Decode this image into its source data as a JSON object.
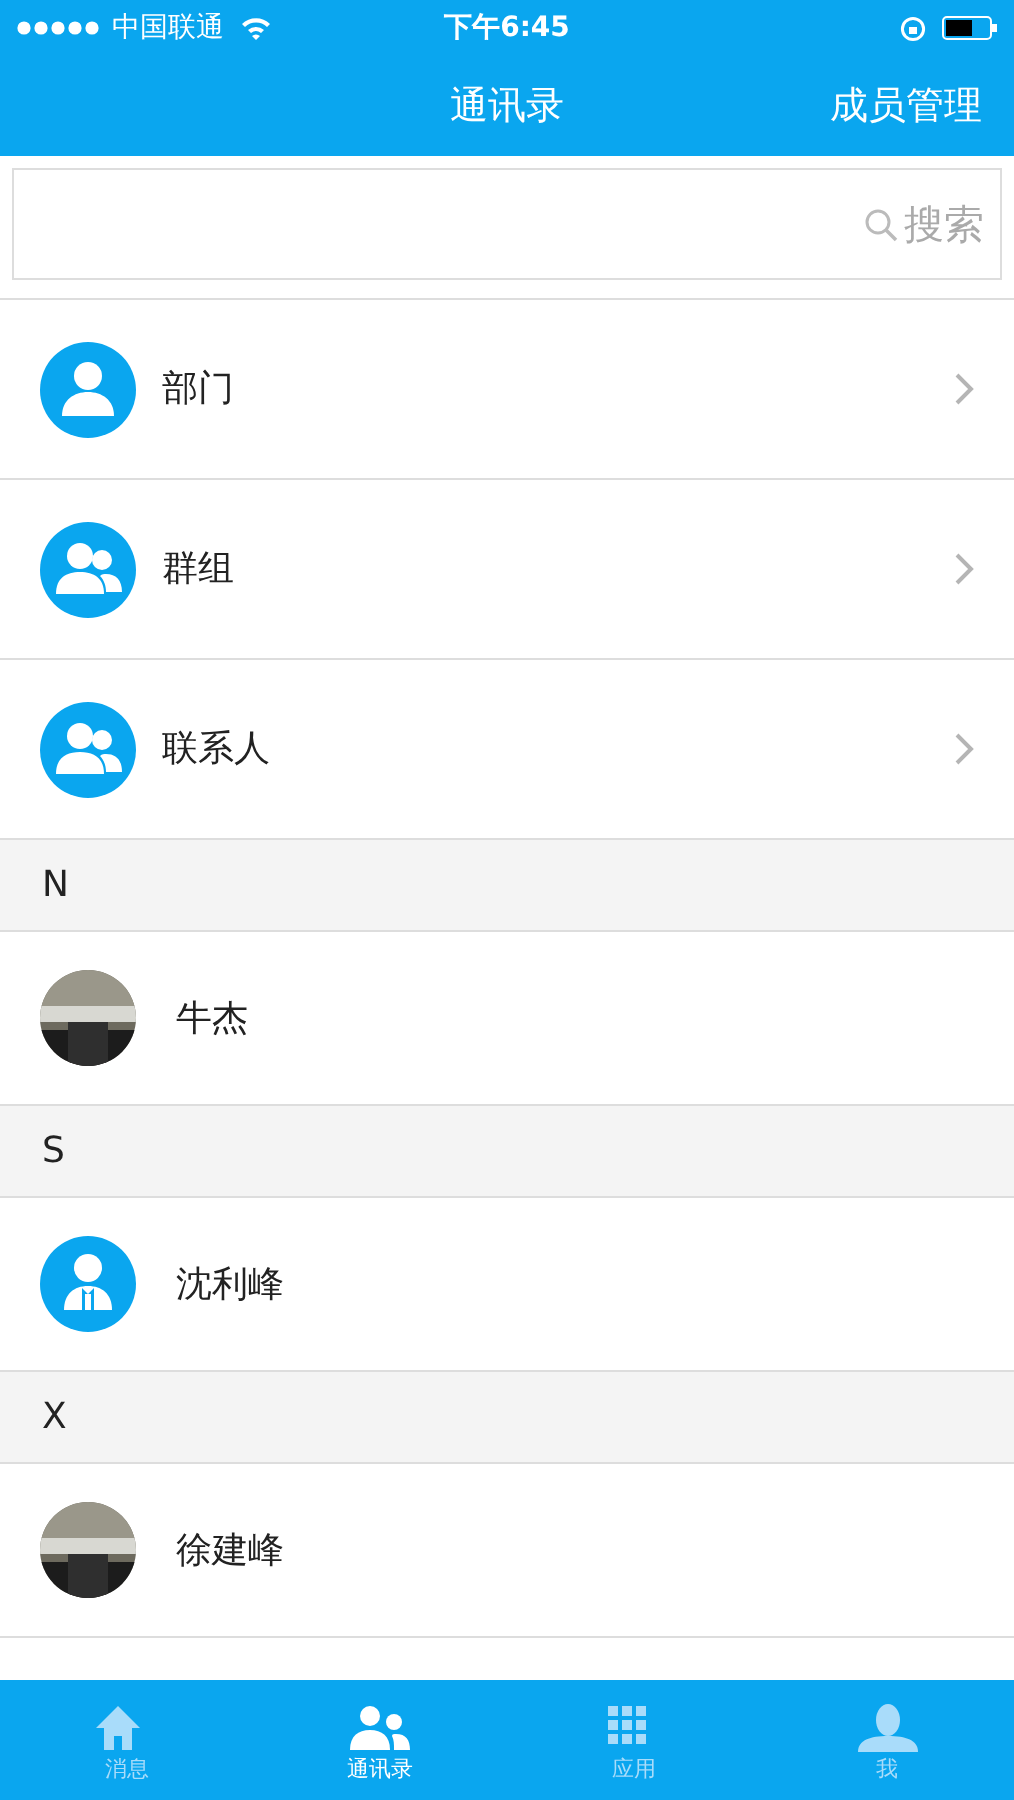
{
  "status_bar": {
    "carrier": "中国联通",
    "time": "下午6:45"
  },
  "nav": {
    "title": "通讯录",
    "action": "成员管理"
  },
  "search": {
    "placeholder": "搜索"
  },
  "groups": [
    {
      "label": "部门",
      "kind": "person"
    },
    {
      "label": "群组",
      "kind": "group"
    },
    {
      "label": "联系人",
      "kind": "group"
    }
  ],
  "sections": [
    {
      "letter": "N",
      "contacts": [
        {
          "name": "牛杰",
          "kind": "picture"
        }
      ]
    },
    {
      "letter": "S",
      "contacts": [
        {
          "name": "沈利峰",
          "kind": "default"
        }
      ]
    },
    {
      "letter": "X",
      "contacts": [
        {
          "name": "徐建峰",
          "kind": "picture"
        }
      ]
    }
  ],
  "tab_bar": [
    {
      "label": "消息",
      "kind": "home",
      "selected": false
    },
    {
      "label": "通讯录",
      "kind": "contacts",
      "selected": true
    },
    {
      "label": "应用",
      "kind": "apps",
      "selected": false
    },
    {
      "label": "我",
      "kind": "me",
      "selected": false
    }
  ]
}
